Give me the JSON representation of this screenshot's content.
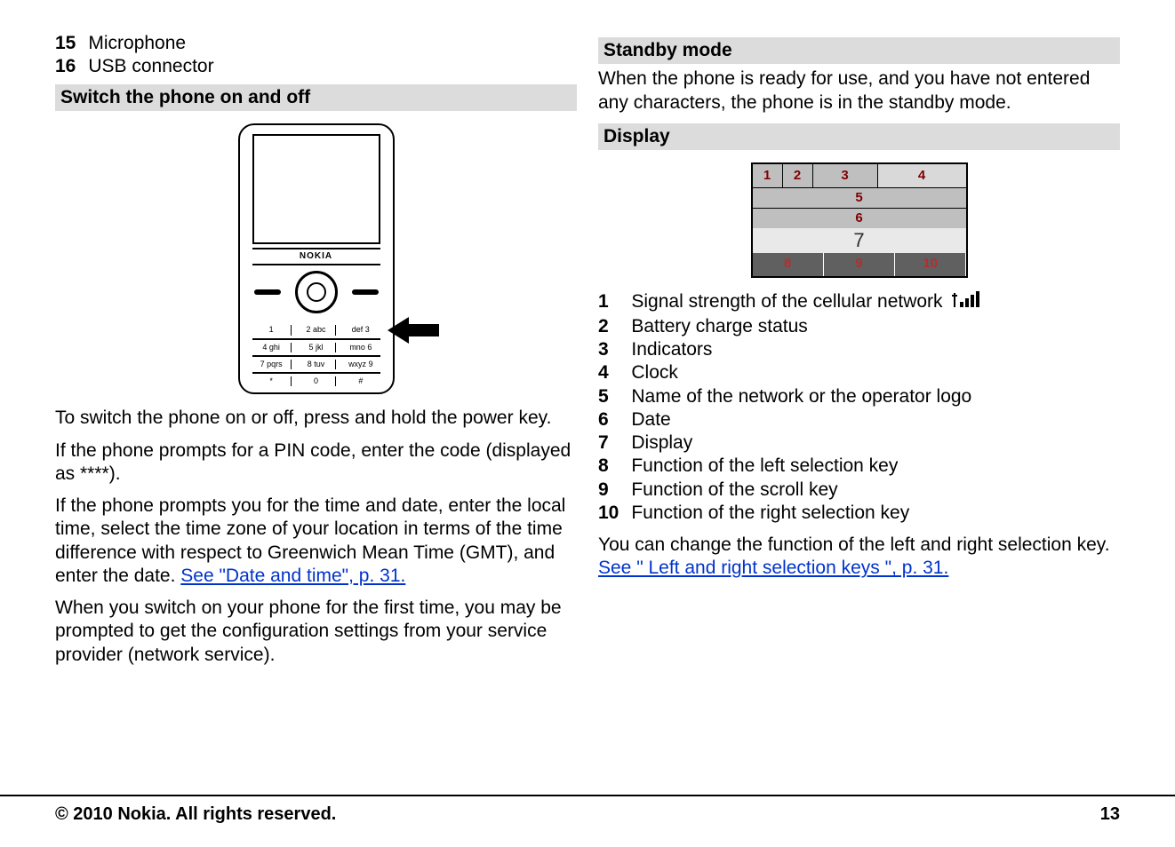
{
  "left": {
    "cont_items": [
      {
        "n": "15",
        "t": "Microphone"
      },
      {
        "n": "16",
        "t": "USB connector"
      }
    ],
    "h_switch": "Switch the phone on and off",
    "phone_brand": "NOKIA",
    "p_switch": "To switch the phone on or off, press and hold the power key.",
    "p_pin": "If the phone prompts for a PIN code, enter the code (displayed as ****).",
    "p_date_a": "If the phone prompts you for the time and date, enter the local time, select the time zone of your location in terms of the time difference with respect to Greenwich Mean Time (GMT), and enter the date. ",
    "link_date": "See \"Date and time\", p. 31.",
    "p_first": "When you switch on your phone for the first time, you may be prompted to get the configuration settings from your service provider (network service)."
  },
  "right": {
    "h_standby": "Standby mode",
    "p_standby": "When the phone is ready for use, and you have not entered any characters, the phone is in the standby mode.",
    "h_display": "Display",
    "disp_items": [
      {
        "n": "1",
        "t": "Signal strength of the cellular network"
      },
      {
        "n": "2",
        "t": "Battery charge status"
      },
      {
        "n": "3",
        "t": "Indicators"
      },
      {
        "n": "4",
        "t": "Clock"
      },
      {
        "n": "5",
        "t": "Name of the network or the operator logo"
      },
      {
        "n": "6",
        "t": "Date"
      },
      {
        "n": "7",
        "t": "Display"
      },
      {
        "n": "8",
        "t": "Function of the left selection key"
      },
      {
        "n": "9",
        "t": "Function of the scroll key"
      },
      {
        "n": "10",
        "t": "Function of the right selection key"
      }
    ],
    "p_change": "You can change the function of the left and right selection key. ",
    "link_keys": "See \" Left and right selection keys \", p. 31.",
    "diag": {
      "n1": "1",
      "n2": "2",
      "n3": "3",
      "n4": "4",
      "n5": "5",
      "n6": "6",
      "n7": "7",
      "n8": "8",
      "n9": "9",
      "n10": "10"
    }
  },
  "footer": {
    "copy": "© 2010 Nokia. All rights reserved.",
    "page": "13"
  }
}
